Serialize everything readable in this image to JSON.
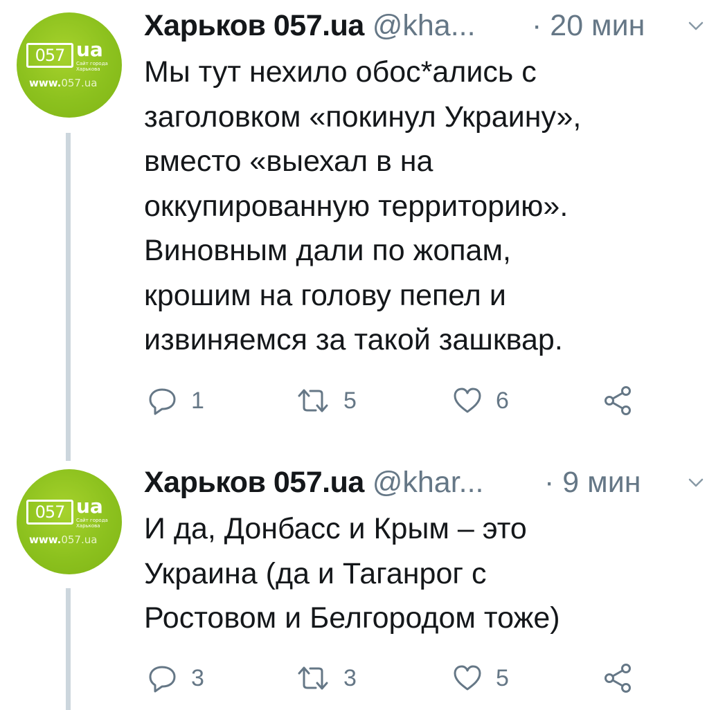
{
  "tweets": [
    {
      "avatar": {
        "logo_number": "057",
        "logo_ua": "ua",
        "logo_sub": "Сайт города Харькова",
        "logo_www_prefix": "www.",
        "logo_www_suffix": "057.ua",
        "brand_color": "#8cc11e"
      },
      "author_name": "Харьков 057.ua",
      "handle": "@kha...",
      "separator": "·",
      "time": "20 мин",
      "text": "Мы тут нехило обос*ались с\nзаголовком «покинул Украину»,\nвместо «выехал в на\nоккупированную территорию».\nВиновным дали по жопам,\nкрошим на голову пепел и\nизвиняемся за такой зашквар.",
      "reply_count": "1",
      "retweet_count": "5",
      "like_count": "6",
      "icons": [
        "reply-icon",
        "retweet-icon",
        "like-icon",
        "share-icon",
        "chevron-down-icon"
      ]
    },
    {
      "avatar": {
        "logo_number": "057",
        "logo_ua": "ua",
        "logo_sub": "Сайт города Харькова",
        "logo_www_prefix": "www.",
        "logo_www_suffix": "057.ua",
        "brand_color": "#8cc11e"
      },
      "author_name": "Харьков 057.ua",
      "handle": "@khar...",
      "separator": "·",
      "time": "9 мин",
      "text": "И да, Донбасс и Крым – это\nУкраина (да и Таганрог с\nРостовом и Белгородом тоже)",
      "reply_count": "3",
      "retweet_count": "3",
      "like_count": "5",
      "icons": [
        "reply-icon",
        "retweet-icon",
        "like-icon",
        "share-icon",
        "chevron-down-icon"
      ]
    }
  ],
  "colors": {
    "text_primary": "#14171a",
    "text_secondary": "#657786",
    "thread_line": "#ccd6dd",
    "background": "#ffffff"
  }
}
